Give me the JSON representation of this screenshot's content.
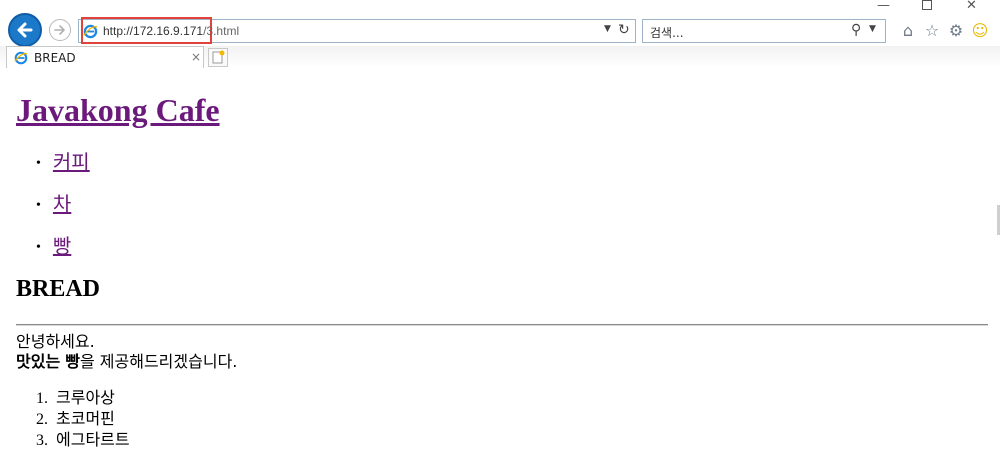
{
  "window": {
    "min_glyph": "—",
    "close_glyph": "✕"
  },
  "addressbar": {
    "url_host": "http://172.16.9.171",
    "url_path": "/3.html"
  },
  "searchbar": {
    "placeholder": "검색..."
  },
  "tab": {
    "title": "BREAD",
    "close_glyph": "×"
  },
  "page": {
    "site_title": "Javakong Cafe",
    "nav": [
      {
        "label": "커피"
      },
      {
        "label": "차"
      },
      {
        "label": "빵"
      }
    ],
    "section_heading": "BREAD",
    "greeting": "안녕하세요.",
    "intro_bold1": "맛있는",
    "intro_mid": " ",
    "intro_bold2": "빵",
    "intro_rest": "을 제공해드리겠습니다.",
    "items": [
      {
        "num": "1.",
        "label": "크루아상"
      },
      {
        "num": "2.",
        "label": "초코머핀"
      },
      {
        "num": "3.",
        "label": "에그타르트"
      }
    ]
  },
  "colors": {
    "accent_blue": "#1c79c9",
    "highlight_red": "#e1433b",
    "visited_link": "#6b1a7b"
  },
  "icons": [
    "back-arrow-icon",
    "forward-arrow-icon",
    "ie-logo-icon",
    "dropdown-icon",
    "refresh-icon",
    "search-icon",
    "home-icon",
    "favorites-star-icon",
    "settings-gear-icon",
    "smiley-feedback-icon",
    "new-tab-icon"
  ]
}
